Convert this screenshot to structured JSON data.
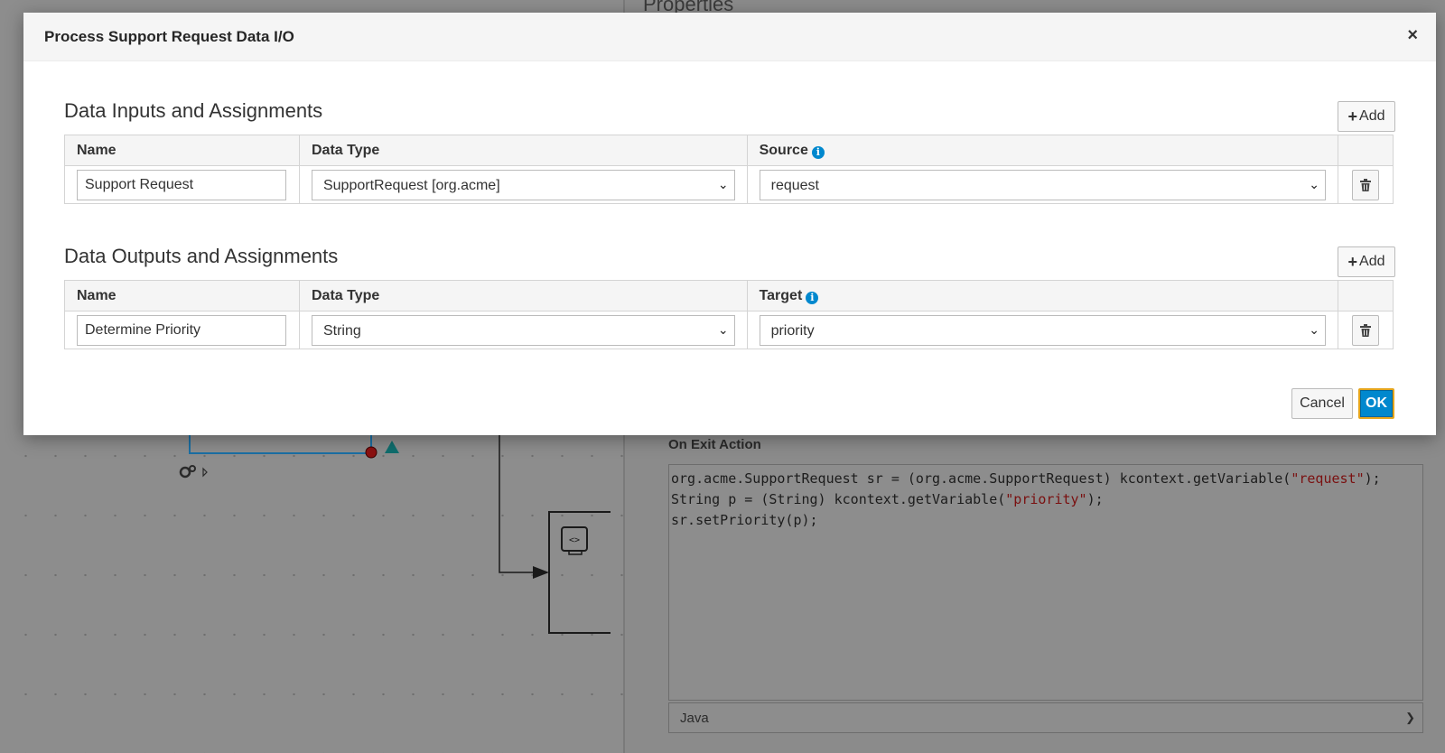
{
  "background": {
    "properties_title": "Properties",
    "on_exit_label": "On Exit Action",
    "code_lines": [
      {
        "pre": "org.acme.SupportRequest sr = (org.acme.SupportRequest) kcontext.getVariable(",
        "str": "\"request\"",
        "post": ");"
      },
      {
        "pre": "String p = (String) kcontext.getVariable(",
        "str": "\"priority\"",
        "post": ");"
      },
      {
        "pre": "sr.setPriority(p);",
        "str": "",
        "post": ""
      }
    ],
    "language": "Java"
  },
  "dialog": {
    "title": "Process Support Request Data I/O",
    "close": "×",
    "inputs": {
      "title": "Data Inputs and Assignments",
      "add_label": "Add",
      "columns": {
        "name": "Name",
        "type": "Data Type",
        "mapping": "Source"
      },
      "row": {
        "name": "Support Request",
        "type": "SupportRequest [org.acme]",
        "mapping": "request"
      }
    },
    "outputs": {
      "title": "Data Outputs and Assignments",
      "add_label": "Add",
      "columns": {
        "name": "Name",
        "type": "Data Type",
        "mapping": "Target"
      },
      "row": {
        "name": "Determine Priority",
        "type": "String",
        "mapping": "priority"
      }
    },
    "cancel_label": "Cancel",
    "ok_label": "OK"
  },
  "colors": {
    "primary": "#0088ce",
    "focus_ring": "#e4a51d",
    "flow_line": "#0088ce",
    "string_literal": "#7a1010"
  }
}
